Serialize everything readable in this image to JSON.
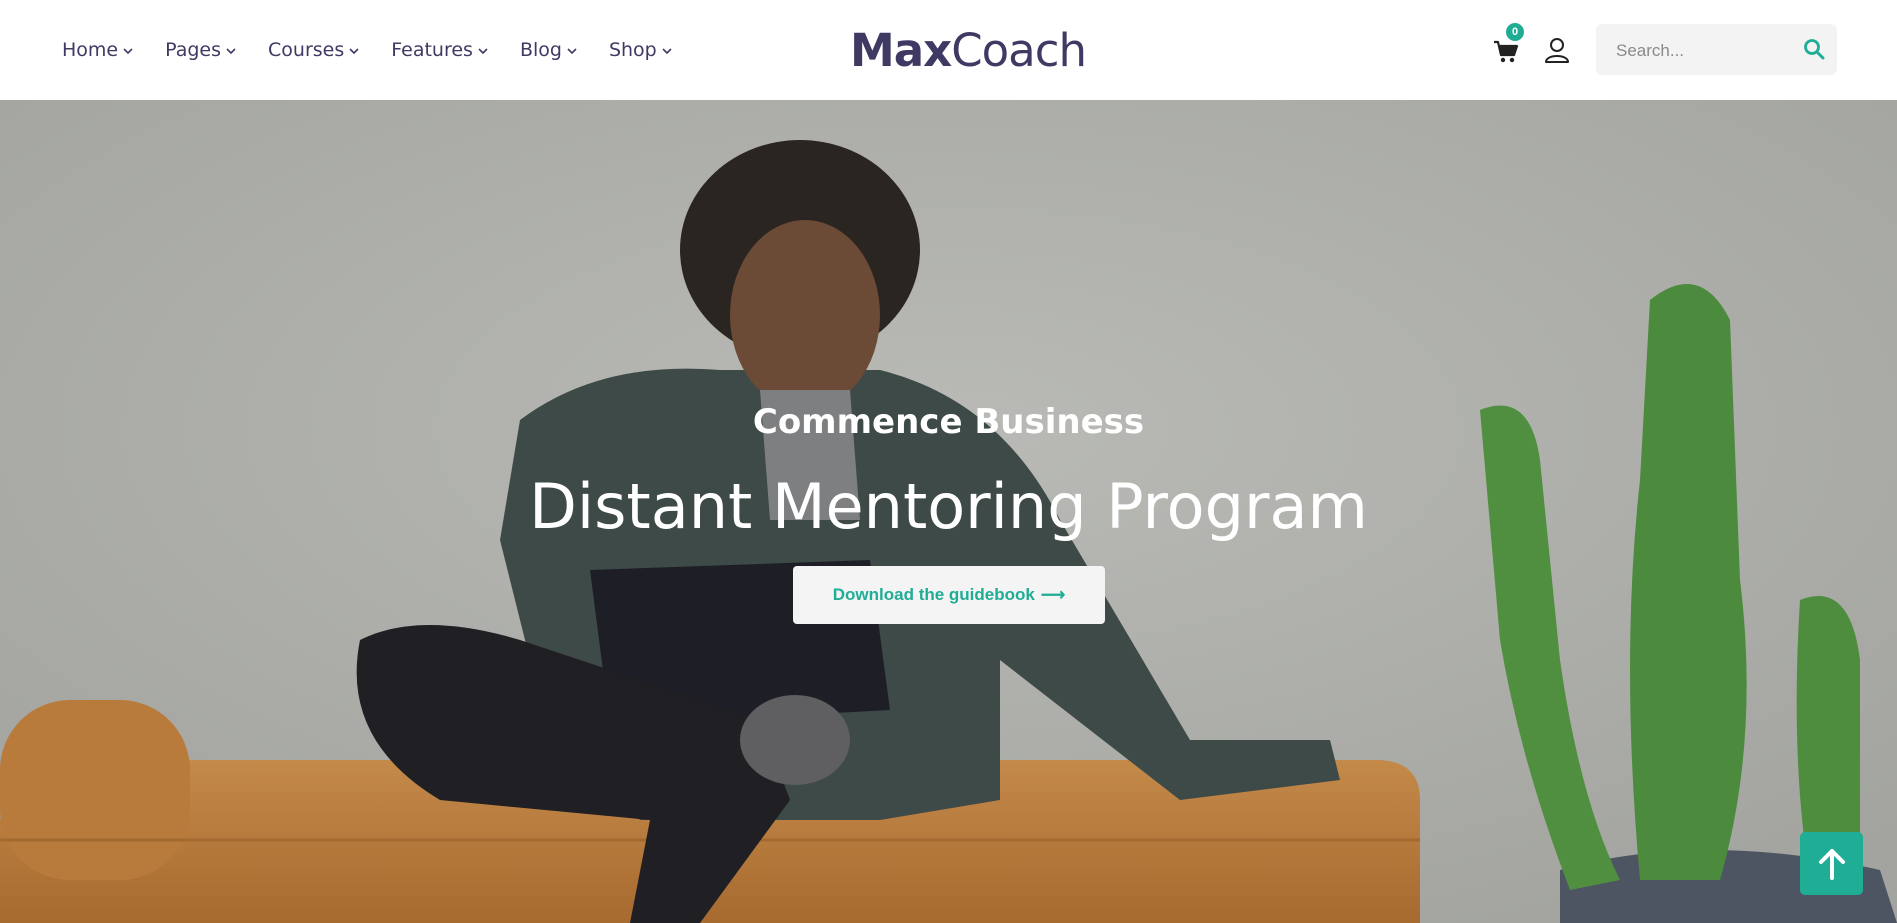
{
  "nav": {
    "items": [
      {
        "label": "Home"
      },
      {
        "label": "Pages"
      },
      {
        "label": "Courses"
      },
      {
        "label": "Features"
      },
      {
        "label": "Blog"
      },
      {
        "label": "Shop"
      }
    ]
  },
  "logo": {
    "part1": "Max",
    "part2": "Coach"
  },
  "header": {
    "cart_count": "0",
    "cart_icon": "cart-icon",
    "user_icon": "user-icon"
  },
  "search": {
    "placeholder": "Search...",
    "icon": "search-icon"
  },
  "hero": {
    "subtitle": "Commence Business",
    "title": "Distant Mentoring Program",
    "button_label": "Download the guidebook",
    "button_arrow": "⟶"
  },
  "scroll_top": {
    "icon": "arrow-up-icon"
  },
  "colors": {
    "accent": "#20ad96",
    "brand": "#3f3a64",
    "search_bg": "#f3f3f3"
  }
}
